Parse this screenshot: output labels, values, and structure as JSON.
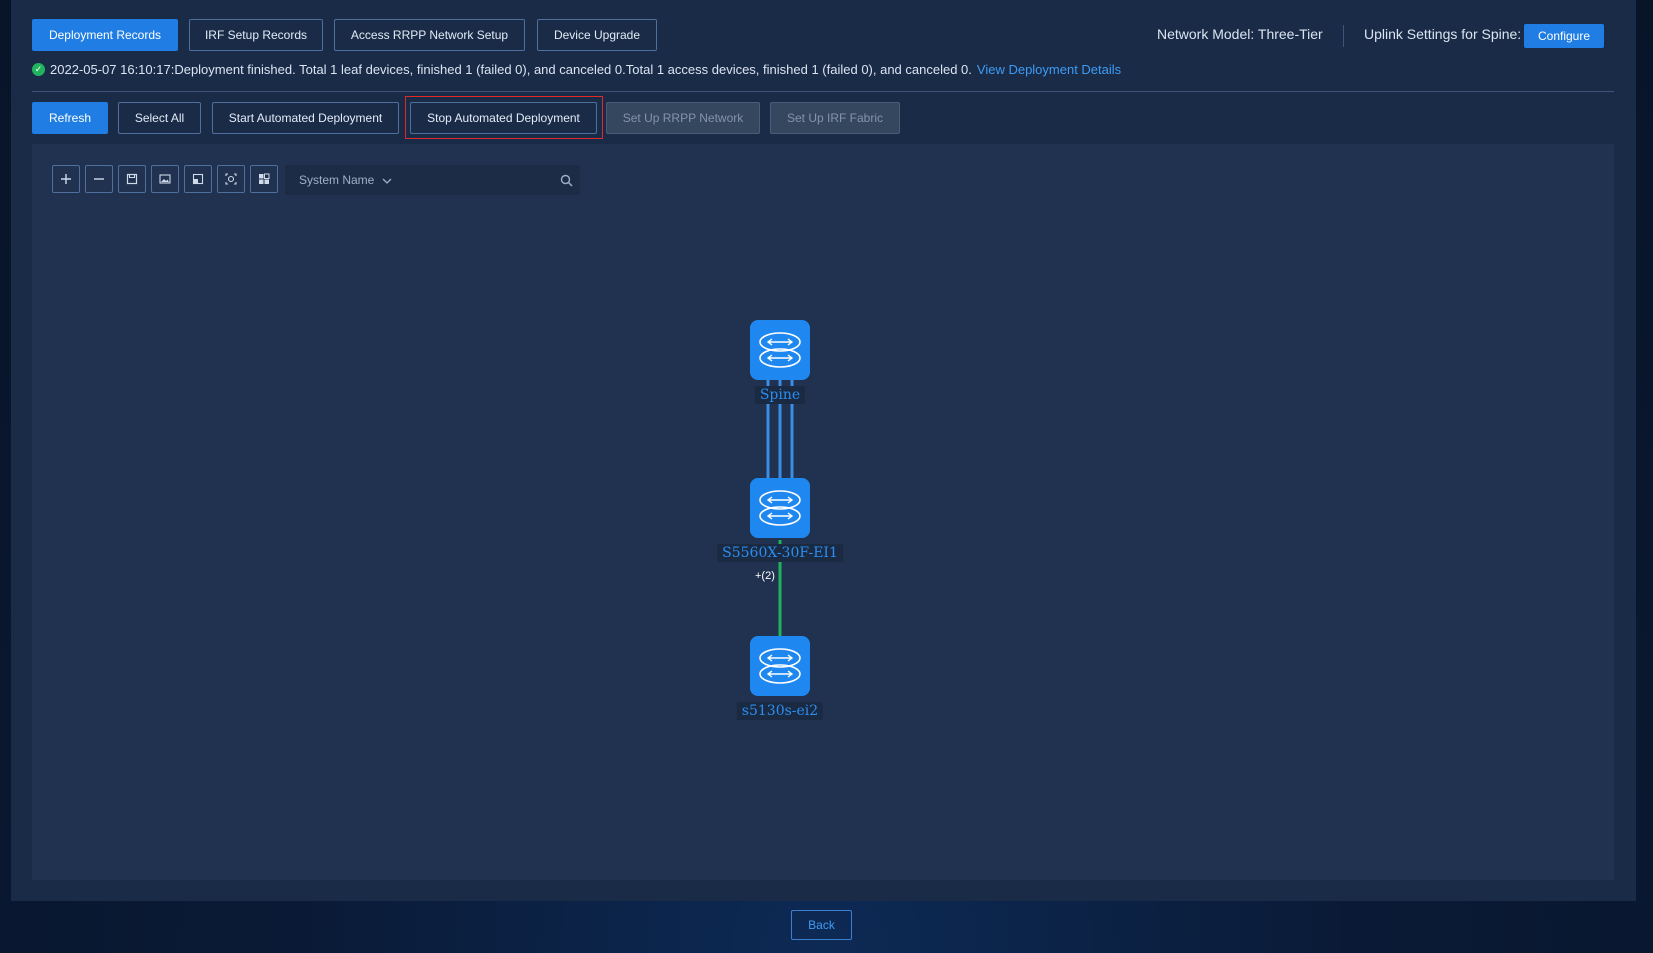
{
  "tabs": {
    "deployment_records": "Deployment Records",
    "irf_setup_records": "IRF Setup Records",
    "access_rrpp": "Access RRPP Network Setup",
    "device_upgrade": "Device Upgrade"
  },
  "header": {
    "network_model": "Network Model: Three-Tier",
    "uplink_settings": "Uplink Settings for Spine:",
    "configure_label": "Configure"
  },
  "status": {
    "message": "2022-05-07 16:10:17:Deployment finished.  Total 1 leaf devices, finished 1 (failed 0), and canceled 0.Total  1 access devices, finished 1 (failed 0), and canceled 0.",
    "link_text": "View Deployment Details",
    "color": "#22b35e"
  },
  "toolbar": {
    "refresh": "Refresh",
    "select_all": "Select All",
    "start_auto": "Start Automated Deployment",
    "stop_auto": "Stop Automated Deployment",
    "setup_rrpp": "Set Up RRPP Network",
    "setup_irf": "Set Up IRF Fabric"
  },
  "topology_tools": {
    "search_field_label": "System Name",
    "search_value": "",
    "icons": [
      "zoom-in-icon",
      "zoom-out-icon",
      "save-icon",
      "export-image-icon",
      "fit-view-icon",
      "locate-icon",
      "layout-icon"
    ]
  },
  "topology": {
    "nodes": [
      {
        "label": "Spine"
      },
      {
        "label": "S5560X-30F-EI1"
      },
      {
        "label": "s5130s-ei2"
      }
    ],
    "link_count_label": "+(2)",
    "colors": {
      "node": "#1e88f0",
      "spine_links": "#3a8ee6",
      "access_link": "#21b35c"
    }
  },
  "footer": {
    "back_label": "Back"
  },
  "colors": {
    "primary": "#1f7de3",
    "panel": "#1a2b48",
    "canvas": "#20324f",
    "highlight": "#e02a2a"
  }
}
